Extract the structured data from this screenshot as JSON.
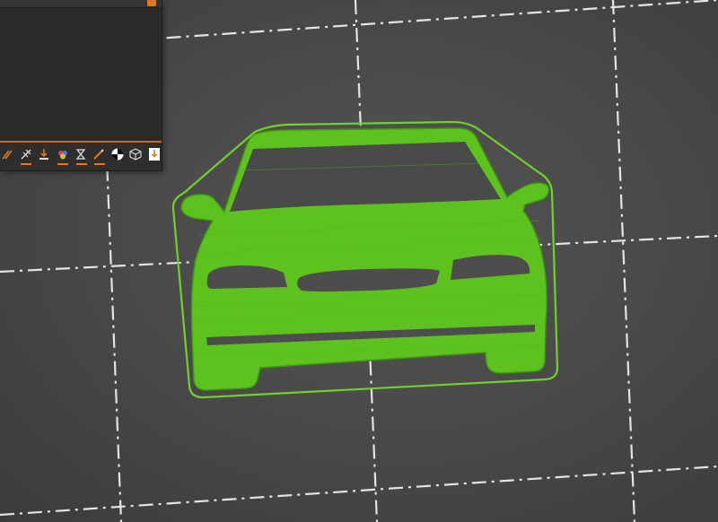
{
  "app": {
    "view": "3d-build-plate"
  },
  "colors": {
    "model_fill": "#5ec21e",
    "model_edge": "#3f9a10",
    "skirt": "#6fd12a",
    "grid_line": "#f2f2f2",
    "panel_bg": "#2c2c2c",
    "accent": "#e07a1f"
  },
  "toolbar": {
    "tools": [
      {
        "name": "seam-painting-icon",
        "icon": "seam-painting"
      },
      {
        "name": "support-painting-icon",
        "icon": "support-painting"
      },
      {
        "name": "drop-to-bed-icon",
        "icon": "drop-to-bed"
      },
      {
        "name": "color-painting-icon",
        "icon": "color-painting"
      },
      {
        "name": "variable-layer-height-icon",
        "icon": "variable-layer-height"
      },
      {
        "name": "brim-ears-icon",
        "icon": "brim-ears"
      },
      {
        "name": "measure-icon",
        "icon": "measure"
      },
      {
        "name": "assembly-view-icon",
        "icon": "assembly-view"
      },
      {
        "name": "place-on-face-icon",
        "icon": "place-on-face"
      }
    ]
  }
}
